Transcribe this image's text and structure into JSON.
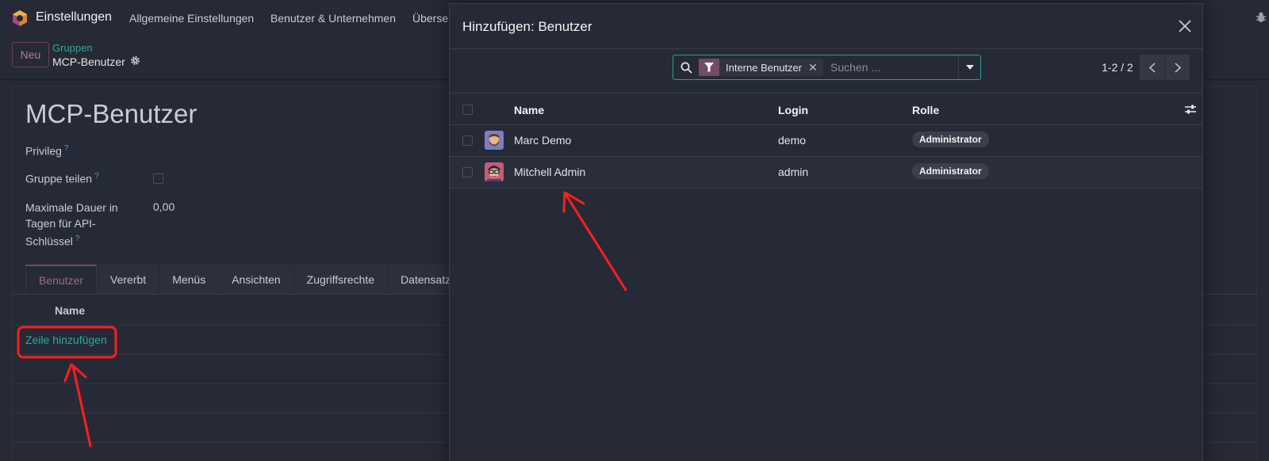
{
  "navbar": {
    "app_name": "Einstellungen",
    "items": [
      "Allgemeine Einstellungen",
      "Benutzer & Unternehmen",
      "Überse"
    ]
  },
  "control_panel": {
    "new_button": "Neu",
    "breadcrumb_parent": "Gruppen",
    "breadcrumb_current": "MCP-Benutzer"
  },
  "form": {
    "title": "MCP-Benutzer",
    "privilege_label": "Privileg",
    "share_group_label": "Gruppe teilen",
    "max_duration_label_1": "Maximale Dauer in",
    "max_duration_label_2": "Tagen für API-",
    "max_duration_label_3": "Schlüssel",
    "max_duration_value": "0,00",
    "help_mark": "?",
    "tabs": [
      "Benutzer",
      "Vererbt",
      "Menüs",
      "Ansichten",
      "Zugriffsrechte",
      "Datensatz"
    ],
    "list_header_name": "Name",
    "add_line": "Zeile hinzufügen"
  },
  "modal": {
    "title": "Hinzufügen: Benutzer",
    "search": {
      "facet": "Interne Benutzer",
      "facet_remove": "✕",
      "placeholder": "Suchen ..."
    },
    "pager": "1-2 / 2",
    "columns": {
      "name": "Name",
      "login": "Login",
      "role": "Rolle"
    },
    "rows": [
      {
        "name": "Marc Demo",
        "login": "demo",
        "role": "Administrator"
      },
      {
        "name": "Mitchell Admin",
        "login": "admin",
        "role": "Administrator"
      }
    ]
  },
  "colors": {
    "background": "#262a36",
    "accent_purple": "#714b67",
    "link_teal": "#2fa89a",
    "annotation_red": "#ff1e1e"
  }
}
